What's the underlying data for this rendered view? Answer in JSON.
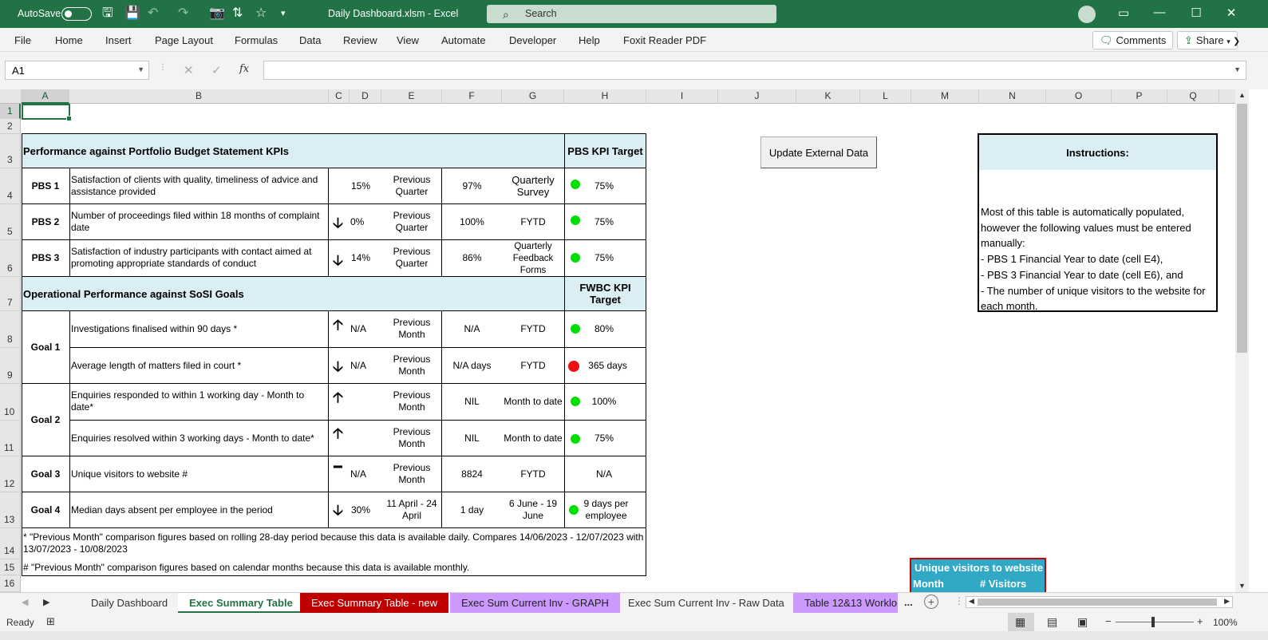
{
  "titlebar": {
    "autosave_label": "AutoSave",
    "autosave_state": "Off",
    "doc_title": "Daily Dashboard.xlsm  -  Excel",
    "search_placeholder": "Search",
    "accent_color": "#217346"
  },
  "menu": {
    "items": [
      "File",
      "Home",
      "Insert",
      "Page Layout",
      "Formulas",
      "Data",
      "Review",
      "View",
      "Automate",
      "Developer",
      "Help",
      "Foxit Reader PDF"
    ],
    "comments_label": "Comments",
    "share_label": "Share"
  },
  "formula_bar": {
    "name_box": "A1",
    "fx": "fx",
    "content": ""
  },
  "columns": [
    "A",
    "B",
    "C",
    "D",
    "E",
    "F",
    "G",
    "H",
    "I",
    "J",
    "K",
    "L",
    "M",
    "N",
    "O",
    "P",
    "Q"
  ],
  "rows": [
    "1",
    "2",
    "3",
    "4",
    "5",
    "6",
    "7",
    "8",
    "9",
    "10",
    "11",
    "12",
    "13",
    "14",
    "15",
    "16"
  ],
  "table": {
    "section1_title": "Performance against Portfolio Budget Statement KPIs",
    "section1_target_header": "PBS KPI Target",
    "section2_title": "Operational Performance against SoSI Goals",
    "section2_target_header": "FWBC KPI Target",
    "rows": [
      {
        "label": "PBS 1",
        "desc": "Satisfaction of clients with quality, timeliness of advice and assistance provided",
        "arrow": "",
        "value": "15%",
        "period": "Previous Quarter",
        "current": "97%",
        "source": "Quarterly Survey",
        "status": "green",
        "target": "75%"
      },
      {
        "label": "PBS 2",
        "desc": "Number of proceedings filed within 18 months of complaint date",
        "arrow": "down",
        "value": "0%",
        "period": "Previous Quarter",
        "current": "100%",
        "source": "FYTD",
        "status": "green",
        "target": "75%"
      },
      {
        "label": "PBS 3",
        "desc": "Satisfaction of industry participants with contact aimed at promoting appropriate standards of conduct",
        "arrow": "down",
        "value": "14%",
        "period": "Previous Quarter",
        "current": "86%",
        "source": "Quarterly Feedback Forms",
        "status": "green",
        "target": "75%"
      },
      {
        "label": "Goal 1",
        "desc": "Investigations finalised within 90 days *",
        "arrow": "up",
        "value": "N/A",
        "period": "Previous Month",
        "current": "N/A",
        "source": "FYTD",
        "status": "green",
        "target": "80%"
      },
      {
        "label": "",
        "desc": "Average length of matters filed in court *",
        "arrow": "down",
        "value": "N/A",
        "period": "Previous Month",
        "current": "N/A days",
        "source": "FYTD",
        "status": "red",
        "target": "365 days"
      },
      {
        "label": "Goal 2",
        "desc": "Enquiries responded to within 1 working day - Month to date*",
        "arrow": "up",
        "value": "",
        "period": "Previous Month",
        "current": "NIL",
        "source": "Month to date",
        "status": "green",
        "target": "100%"
      },
      {
        "label": "",
        "desc": "Enquiries resolved within 3 working days - Month to date*",
        "arrow": "up",
        "value": "",
        "period": "Previous Month",
        "current": "NIL",
        "source": "Month to date",
        "status": "green",
        "target": "75%"
      },
      {
        "label": "Goal 3",
        "desc": "Unique visitors to website #",
        "arrow": "flat",
        "value": "N/A",
        "period": "Previous Month",
        "current": "8824",
        "source": "FYTD",
        "status": "",
        "target": "N/A"
      },
      {
        "label": "Goal 4",
        "desc": "Median days absent per employee in the period",
        "arrow": "down",
        "value": "30%",
        "period": "11 April - 24 April",
        "current": "1 day",
        "source": "6 June - 19 June",
        "status": "green",
        "target": "9 days per employee"
      }
    ],
    "footnote1": "* \"Previous Month\" comparison figures based on rolling 28-day period because this data is available daily.  Compares  14/06/2023 - 12/07/2023 with 13/07/2023 - 10/08/2023",
    "footnote2": "# \"Previous Month\" comparison figures based on calendar months because this data is available monthly."
  },
  "update_button": "Update External Data",
  "instructions": {
    "title": "Instructions:",
    "body": "Most of this table is automatically populated, however the following values must be entered manually:\n - PBS 1 Financial Year to date (cell E4),\n - PBS 3 Financial Year to date (cell E6), and\n - The number of unique visitors to the website for each month."
  },
  "visitors_table": {
    "title": "Unique visitors to website",
    "col1": "Month",
    "col2": "# Visitors"
  },
  "sheet_tabs": [
    "Daily Dashboard",
    "Exec Summary Table",
    "Exec Summary Table - new",
    "Exec Sum Current Inv - GRAPH",
    "Exec Sum Current Inv - Raw Data",
    "Table 12&13 Worklo"
  ],
  "sheet_tabs_more": "...",
  "status": {
    "ready": "Ready",
    "zoom": "100%"
  }
}
